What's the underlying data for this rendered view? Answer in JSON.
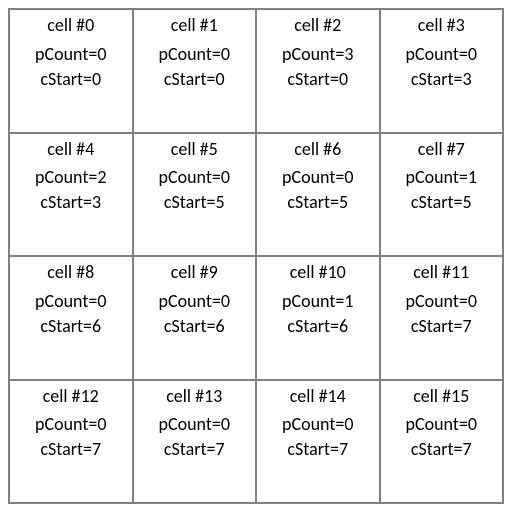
{
  "labels": {
    "cell_prefix": "cell #",
    "pcount_prefix": "pCount=",
    "cstart_prefix": "cStart="
  },
  "cells": [
    {
      "id": "0",
      "pCount": "0",
      "cStart": "0"
    },
    {
      "id": "1",
      "pCount": "0",
      "cStart": "0"
    },
    {
      "id": "2",
      "pCount": "3",
      "cStart": "0"
    },
    {
      "id": "3",
      "pCount": "0",
      "cStart": "3"
    },
    {
      "id": "4",
      "pCount": "2",
      "cStart": "3"
    },
    {
      "id": "5",
      "pCount": "0",
      "cStart": "5"
    },
    {
      "id": "6",
      "pCount": "0",
      "cStart": "5"
    },
    {
      "id": "7",
      "pCount": "1",
      "cStart": "5"
    },
    {
      "id": "8",
      "pCount": "0",
      "cStart": "6"
    },
    {
      "id": "9",
      "pCount": "0",
      "cStart": "6"
    },
    {
      "id": "10",
      "pCount": "1",
      "cStart": "6"
    },
    {
      "id": "11",
      "pCount": "0",
      "cStart": "7"
    },
    {
      "id": "12",
      "pCount": "0",
      "cStart": "7"
    },
    {
      "id": "13",
      "pCount": "0",
      "cStart": "7"
    },
    {
      "id": "14",
      "pCount": "0",
      "cStart": "7"
    },
    {
      "id": "15",
      "pCount": "0",
      "cStart": "7"
    }
  ]
}
